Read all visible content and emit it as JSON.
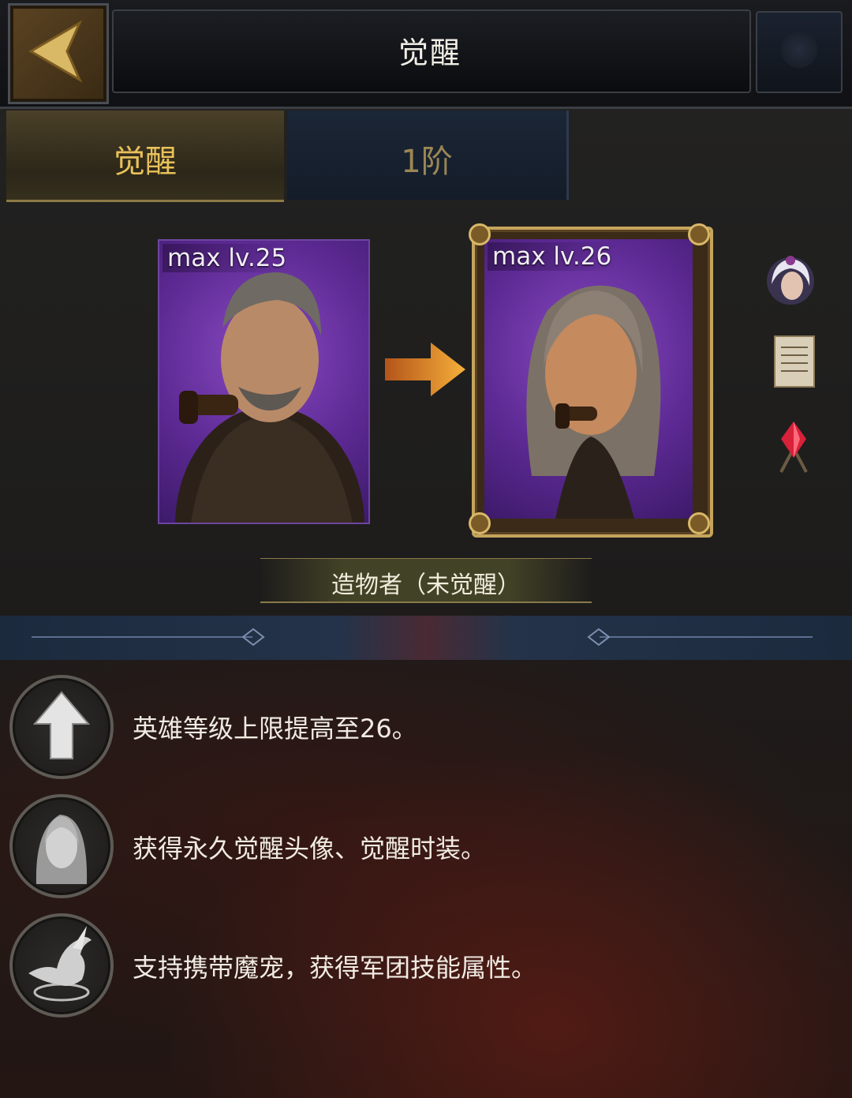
{
  "header": {
    "title": "觉醒"
  },
  "tabs": [
    {
      "label": "觉醒",
      "active": true
    },
    {
      "label": "1阶",
      "active": false
    }
  ],
  "cards": {
    "current": {
      "level_label": "max lv.25"
    },
    "next": {
      "level_label": "max lv.26"
    }
  },
  "side_icons": [
    "hero-avatar-icon",
    "scroll-document-icon",
    "red-crystal-icon"
  ],
  "hero": {
    "name": "造物者（未觉醒）"
  },
  "features": [
    {
      "icon": "up-arrow-icon",
      "text": "英雄等级上限提高至26。"
    },
    {
      "icon": "portrait-icon",
      "text": "获得永久觉醒头像、觉醒时装。"
    },
    {
      "icon": "dragon-pet-icon",
      "text": "支持携带魔宠，获得军团技能属性。"
    }
  ],
  "colors": {
    "accent_gold": "#e8c15a",
    "card_purple": "#5d2a94",
    "frame_gold": "#c5a45c"
  }
}
